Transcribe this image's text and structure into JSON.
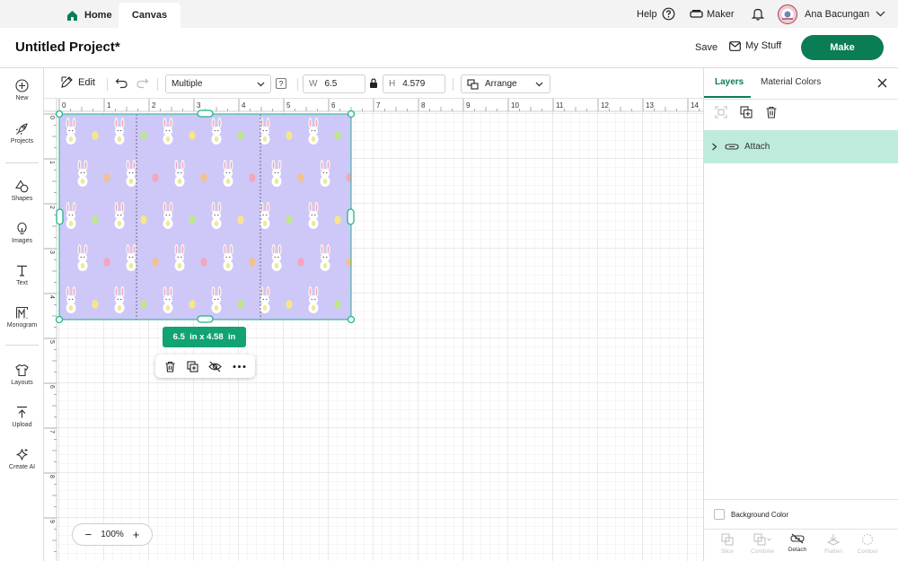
{
  "tabs": {
    "home": "Home",
    "canvas": "Canvas"
  },
  "header": {
    "help": "Help",
    "maker": "Maker",
    "user": "Ana Bacungan"
  },
  "project": {
    "title": "Untitled Project*",
    "save": "Save",
    "my_stuff": "My Stuff",
    "make": "Make"
  },
  "sidebar": {
    "items": [
      {
        "label": "New",
        "icon": "plus-circle-icon"
      },
      {
        "label": "Projects",
        "icon": "rocket-icon"
      },
      {
        "label": "Shapes",
        "icon": "shapes-icon"
      },
      {
        "label": "Images",
        "icon": "lightbulb-icon"
      },
      {
        "label": "Text",
        "icon": "text-t-icon"
      },
      {
        "label": "Monogram",
        "icon": "monogram-icon"
      },
      {
        "label": "Layouts",
        "icon": "shirt-icon"
      },
      {
        "label": "Upload",
        "icon": "upload-icon"
      },
      {
        "label": "Create AI",
        "icon": "sparkle-icon"
      }
    ]
  },
  "editbar": {
    "edit": "Edit",
    "operation": "Multiple",
    "help_q": "?",
    "w_label": "W",
    "w_value": "6.5",
    "h_label": "H",
    "h_value": "4.579",
    "arrange": "Arrange"
  },
  "ruler": {
    "top": [
      "0",
      "1",
      "2",
      "3",
      "4",
      "5",
      "6",
      "7",
      "8",
      "9",
      "10",
      "11",
      "12",
      "13",
      "14"
    ],
    "left": [
      "0",
      "1",
      "2",
      "3",
      "4",
      "5",
      "6",
      "7",
      "8",
      "9"
    ]
  },
  "canvas": {
    "size_label": "6.5  in x 4.58  in",
    "zoom": "100%",
    "zoom_minus": "−",
    "zoom_plus": "+"
  },
  "layers_panel": {
    "tab_layers": "Layers",
    "tab_material": "Material Colors",
    "layer_name": "Attach",
    "background_color": "Background Color",
    "bottom_tools": [
      "Slice",
      "Combine",
      "Detach",
      "Flatten",
      "Contour"
    ]
  },
  "colors": {
    "accent": "#0b7d54",
    "selection": "#1db589",
    "layer_highlight": "#bfebdd",
    "pattern_bg": "#cdc8f8"
  }
}
